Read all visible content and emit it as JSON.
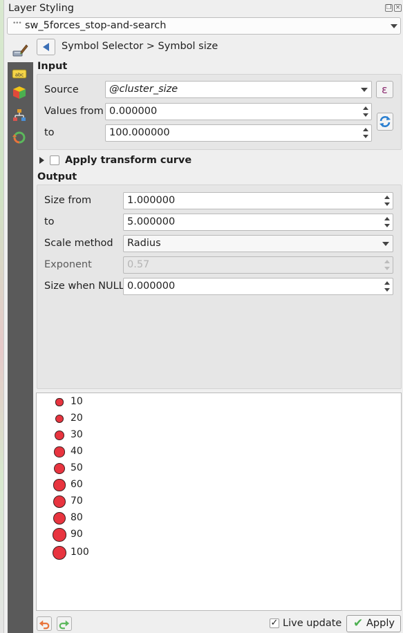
{
  "window": {
    "title": "Layer Styling"
  },
  "layer_selector": {
    "value": "sw_5forces_stop-and-search"
  },
  "header": {
    "breadcrumb": "Symbol Selector > Symbol size"
  },
  "input": {
    "title": "Input",
    "source_label": "Source",
    "source_value": "@cluster_size",
    "expression_button": "ε",
    "values_from_label": "Values from",
    "values_from": "0.000000",
    "to_label": "to",
    "to_value": "100.000000"
  },
  "transform": {
    "label": "Apply transform curve",
    "checked": false
  },
  "output": {
    "title": "Output",
    "size_from_label": "Size from",
    "size_from": "1.000000",
    "to_label": "to",
    "to_value": "5.000000",
    "scale_method_label": "Scale method",
    "scale_method": "Radius",
    "exponent_label": "Exponent",
    "exponent": "0.57",
    "size_null_label": "Size when NULL",
    "size_null": "0.000000"
  },
  "preview": {
    "items": [
      {
        "label": "10",
        "size_value": 10
      },
      {
        "label": "20",
        "size_value": 20
      },
      {
        "label": "30",
        "size_value": 30
      },
      {
        "label": "40",
        "size_value": 40
      },
      {
        "label": "50",
        "size_value": 50
      },
      {
        "label": "60",
        "size_value": 60
      },
      {
        "label": "70",
        "size_value": 70
      },
      {
        "label": "80",
        "size_value": 80
      },
      {
        "label": "90",
        "size_value": 90
      },
      {
        "label": "100",
        "size_value": 100
      }
    ]
  },
  "footer": {
    "live_update_label": "Live update",
    "live_update": true,
    "apply_label": "Apply"
  },
  "colors": {
    "symbol_fill": "#e8343f",
    "sidebar": "#5a5a5a",
    "accent": "#3b6fb6"
  }
}
